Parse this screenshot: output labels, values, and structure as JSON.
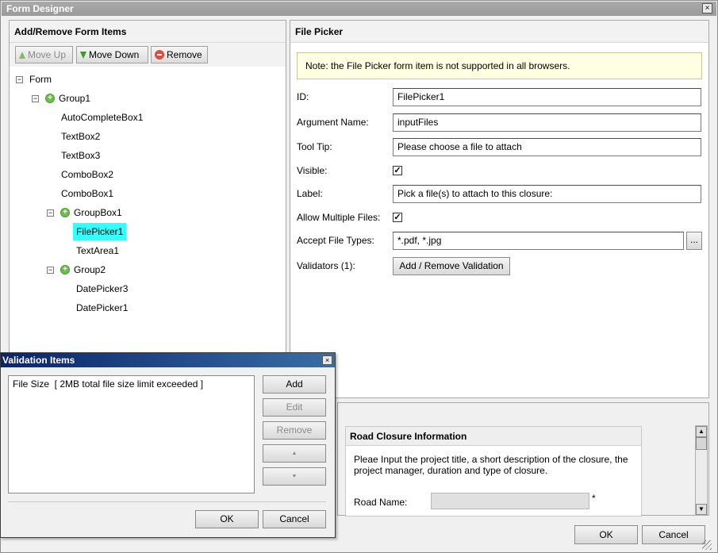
{
  "window": {
    "title": "Form Designer",
    "close_glyph": "×"
  },
  "left_panel": {
    "title": "Add/Remove Form Items",
    "toolbar": {
      "move_up": "Move Up",
      "move_down": "Move Down",
      "remove": "Remove"
    },
    "tree": {
      "form": "Form",
      "group1": "Group1",
      "items": [
        "AutoCompleteBox1",
        "TextBox2",
        "TextBox3",
        "ComboBox2",
        "ComboBox1"
      ],
      "groupbox1": "GroupBox1",
      "groupbox_items": [
        "FilePicker1",
        "TextArea1"
      ],
      "group2": "Group2",
      "group2_items": [
        "DatePicker3",
        "DatePicker1"
      ],
      "expander": "−",
      "plus": "+"
    }
  },
  "right_panel": {
    "title": "File Picker",
    "note": "Note: the File Picker form item is not supported in all browsers.",
    "labels": {
      "id": "ID:",
      "argument_name": "Argument Name:",
      "tool_tip": "Tool Tip:",
      "visible": "Visible:",
      "label": "Label:",
      "allow_multiple": "Allow Multiple Files:",
      "accept_types": "Accept File Types:",
      "validators": "Validators (1):"
    },
    "values": {
      "id": "FilePicker1",
      "argument_name": "inputFiles",
      "tool_tip": "Please choose a file to attach",
      "label": "Pick a file(s) to attach to this closure:",
      "accept_types": "*.pdf, *.jpg",
      "check": "✓",
      "browse": "..."
    },
    "validation_button": "Add / Remove Validation"
  },
  "preview": {
    "title": "Road Closure Information",
    "description": "Pleae Input the project title, a short description of the closure, the project manager, duration and type of closure.",
    "road_name_label": "Road Name:",
    "required_mark": "*",
    "scroll_up": "▲",
    "scroll_down": "▼"
  },
  "main_buttons": {
    "ok": "OK",
    "cancel": "Cancel"
  },
  "validation_dialog": {
    "title": "Validation Items",
    "close_glyph": "×",
    "items": [
      "File Size  [ 2MB total file size limit exceeded ]"
    ],
    "buttons": {
      "add": "Add",
      "edit": "Edit",
      "remove": "Remove",
      "up": "▲",
      "down": "▼",
      "ok": "OK",
      "cancel": "Cancel"
    }
  }
}
